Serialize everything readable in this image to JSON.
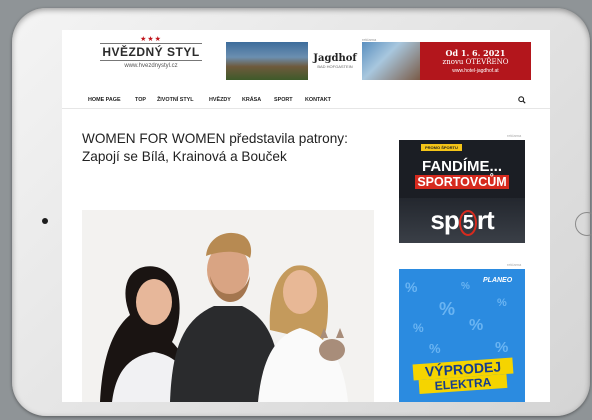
{
  "site": {
    "logo_name": "HVĚZDNÝ STYL",
    "logo_stars": "★★★",
    "logo_url": "www.hvezdnystyl.cz"
  },
  "header_ad": {
    "label": "reklama",
    "brand": "Jagdhof",
    "brand_sub": "BAD HOFGASTEIN",
    "line1": "Od 1. 6. 2021",
    "line2": "znovu OTEVŘENO",
    "line3": "www.hotel-jagdhof.at"
  },
  "nav": {
    "items": [
      "HOME PAGE",
      "TOP",
      "ŽIVOTNÍ STYL",
      "HVĚZDY",
      "KRÁSA",
      "SPORT",
      "KONTAKT"
    ],
    "search_icon": "search-icon"
  },
  "article": {
    "title": "WOMEN FOR WOMEN představila patrony: Zapojí se Bílá, Krainová a Bouček"
  },
  "sidebar": {
    "ad_label_1": "reklama",
    "ad_label_2": "reklama",
    "banner1": {
      "pill": "PROMO ŠPORTU",
      "line1": "FANDÍME...",
      "line2": "SPORTOVCŮM",
      "logo_pre": "sp",
      "logo_five": "5",
      "logo_post": "rt"
    },
    "banner2": {
      "brand": "PLANEO",
      "line1": "VÝPRODEJ",
      "line2": "ELEKTRA"
    }
  },
  "colors": {
    "brand_red": "#c0141b",
    "sport_red": "#d62a1e",
    "planeo_blue": "#2b8be0",
    "promo_yellow": "#f5d400"
  }
}
